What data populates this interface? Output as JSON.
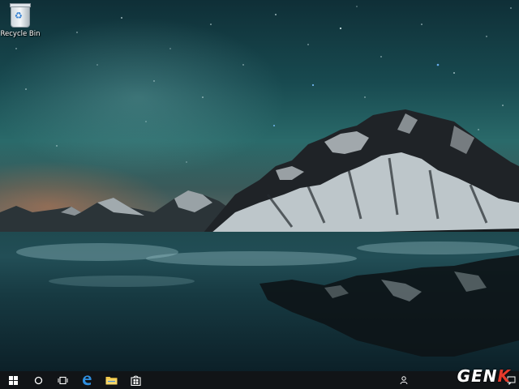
{
  "desktop": {
    "icons": [
      {
        "label": "Recycle Bin",
        "icon": "recycle-bin-icon"
      }
    ]
  },
  "taskbar": {
    "buttons": [
      {
        "name": "start-button",
        "icon": "windows-logo-icon"
      },
      {
        "name": "search-button",
        "icon": "search-circle-icon"
      },
      {
        "name": "task-view-button",
        "icon": "task-view-icon"
      },
      {
        "name": "edge-button",
        "icon": "edge-icon"
      },
      {
        "name": "file-explorer-button",
        "icon": "folder-icon"
      },
      {
        "name": "store-button",
        "icon": "store-icon"
      }
    ],
    "tray": {
      "people_icon": "people-icon",
      "action_center_icon": "notification-icon"
    },
    "accent": "#e53a2c"
  },
  "watermark": {
    "text_main": "GEN",
    "text_accent": "K"
  }
}
